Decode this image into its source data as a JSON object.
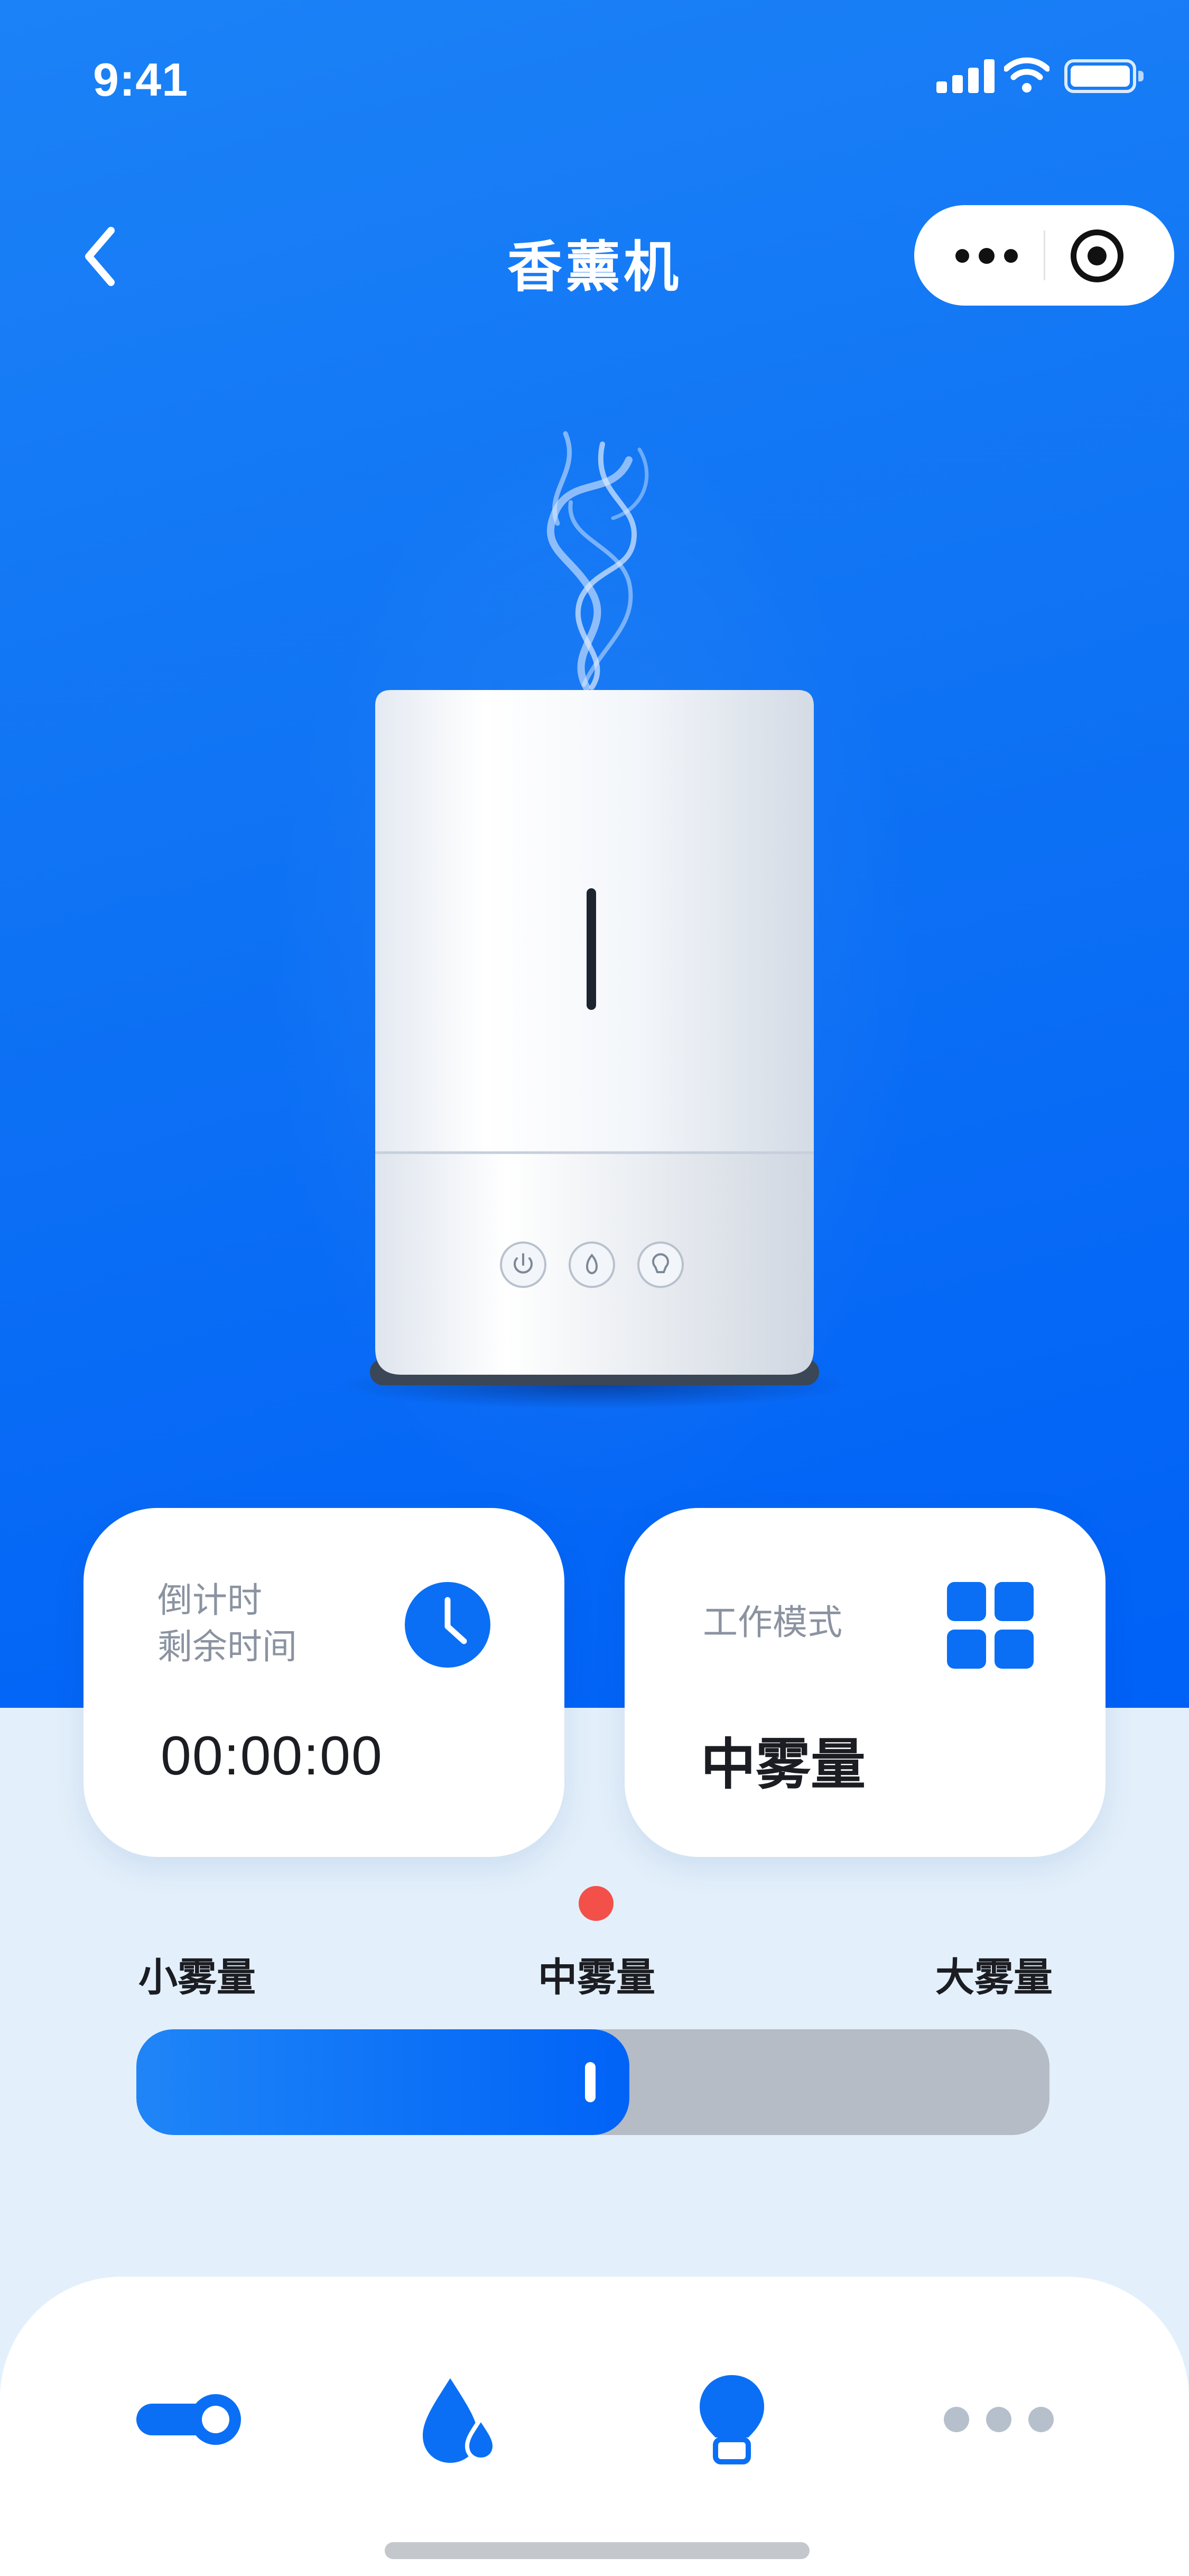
{
  "status_bar": {
    "time": "9:41"
  },
  "nav": {
    "title": "香薰机"
  },
  "colors": {
    "accent": "#0a6ff5",
    "indicator": "#f3504a",
    "track": "#b5bcc5"
  },
  "timer_card": {
    "label_line1": "倒计时",
    "label_line2": "剩余时间",
    "value": "00:00:00",
    "icon": "clock-icon"
  },
  "mode_card": {
    "label": "工作模式",
    "value": "中雾量",
    "icon": "grid-icon"
  },
  "mist_slider": {
    "levels": [
      "小雾量",
      "中雾量",
      "大雾量"
    ],
    "current_level": "中雾量",
    "fill_fraction": 0.54
  },
  "tabbar": {
    "items": [
      {
        "icon": "power-toggle-icon"
      },
      {
        "icon": "water-drops-icon"
      },
      {
        "icon": "light-bulb-icon"
      },
      {
        "icon": "more-dots-icon"
      }
    ]
  }
}
